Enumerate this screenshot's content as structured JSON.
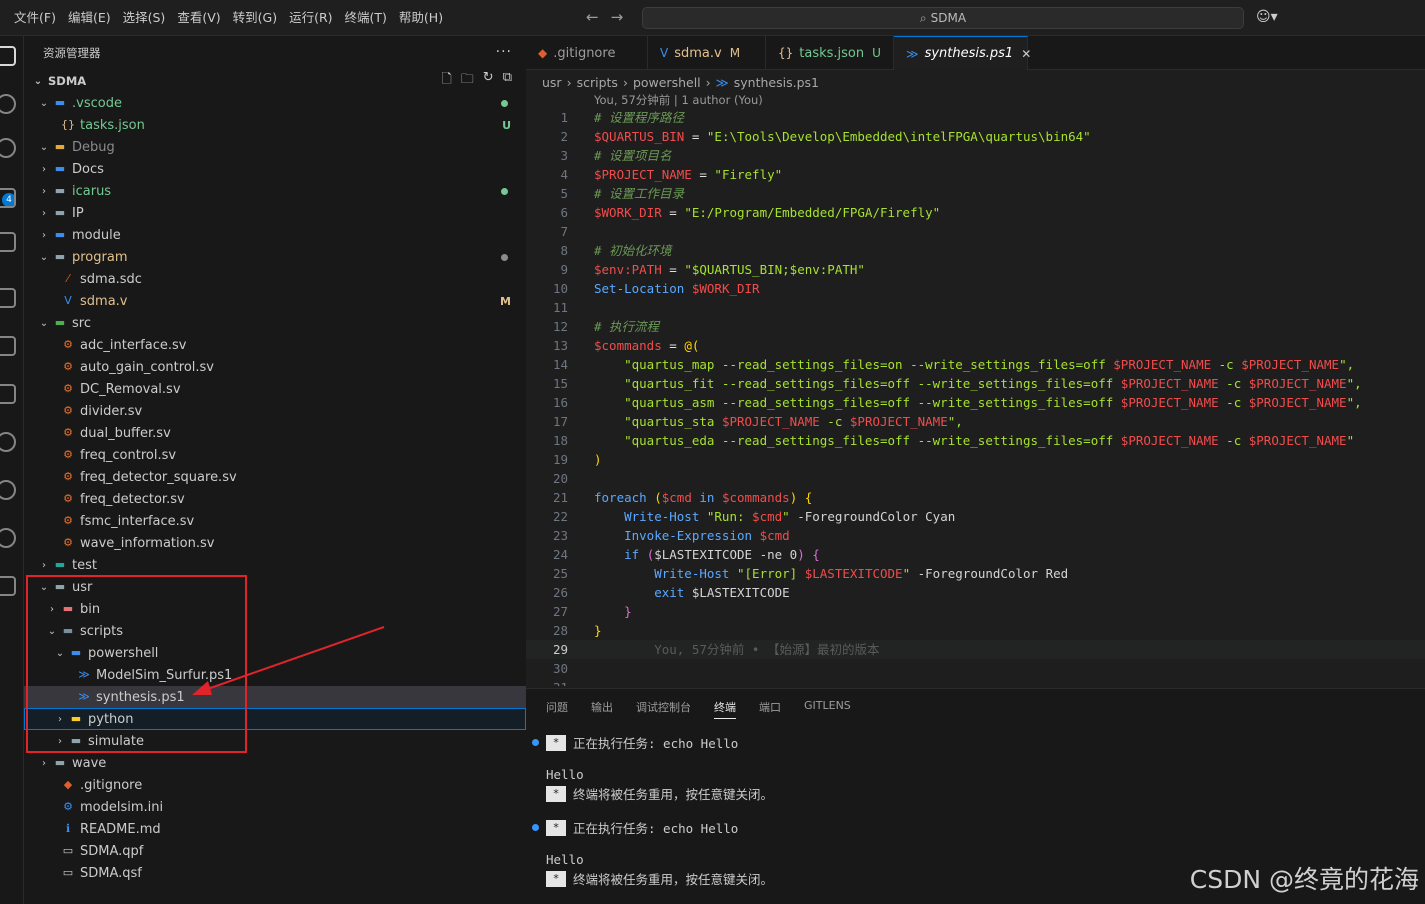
{
  "menu": [
    "文件(F)",
    "编辑(E)",
    "选择(S)",
    "查看(V)",
    "转到(G)",
    "运行(R)",
    "终端(T)",
    "帮助(H)"
  ],
  "search": {
    "text": "SDMA"
  },
  "activity": {
    "badge": "4"
  },
  "sidebar": {
    "title": "资源管理器",
    "folder": "SDMA",
    "tree": [
      {
        "label": ".vscode",
        "indent": 1,
        "chevron": "open",
        "icon": "folder-vscode-icon",
        "color": "#73c991",
        "dot": "#73c991"
      },
      {
        "label": "tasks.json",
        "indent": 2,
        "icon": "json-icon",
        "color": "#73c991",
        "deco": "U",
        "decoColor": "#73c991"
      },
      {
        "label": "Debug",
        "indent": 1,
        "chevron": "open",
        "icon": "folder-debug-icon",
        "color": "#8c8c8c"
      },
      {
        "label": "Docs",
        "indent": 1,
        "chevron": "closed",
        "icon": "folder-docs-icon",
        "color": "#cccccc"
      },
      {
        "label": "icarus",
        "indent": 1,
        "chevron": "closed",
        "icon": "folder-icon",
        "color": "#73c991",
        "dot": "#73c991"
      },
      {
        "label": "IP",
        "indent": 1,
        "chevron": "closed",
        "icon": "folder-icon",
        "color": "#cccccc"
      },
      {
        "label": "module",
        "indent": 1,
        "chevron": "closed",
        "icon": "folder-module-icon",
        "color": "#cccccc"
      },
      {
        "label": "program",
        "indent": 1,
        "chevron": "open",
        "icon": "folder-icon",
        "color": "#e2c08d",
        "dot": "#8c8c8c"
      },
      {
        "label": "sdma.sdc",
        "indent": 2,
        "icon": "sdc-file-icon",
        "color": "#cccccc"
      },
      {
        "label": "sdma.v",
        "indent": 2,
        "icon": "verilog-icon",
        "color": "#e2c08d",
        "deco": "M",
        "decoColor": "#e2c08d"
      },
      {
        "label": "src",
        "indent": 1,
        "chevron": "open",
        "icon": "folder-src-icon",
        "color": "#cccccc"
      },
      {
        "label": "adc_interface.sv",
        "indent": 2,
        "icon": "systemverilog-icon",
        "color": "#cccccc"
      },
      {
        "label": "auto_gain_control.sv",
        "indent": 2,
        "icon": "systemverilog-icon",
        "color": "#cccccc"
      },
      {
        "label": "DC_Removal.sv",
        "indent": 2,
        "icon": "systemverilog-icon",
        "color": "#cccccc"
      },
      {
        "label": "divider.sv",
        "indent": 2,
        "icon": "systemverilog-icon",
        "color": "#cccccc"
      },
      {
        "label": "dual_buffer.sv",
        "indent": 2,
        "icon": "systemverilog-icon",
        "color": "#cccccc"
      },
      {
        "label": "freq_control.sv",
        "indent": 2,
        "icon": "systemverilog-icon",
        "color": "#cccccc"
      },
      {
        "label": "freq_detector_square.sv",
        "indent": 2,
        "icon": "systemverilog-icon",
        "color": "#cccccc"
      },
      {
        "label": "freq_detector.sv",
        "indent": 2,
        "icon": "systemverilog-icon",
        "color": "#cccccc"
      },
      {
        "label": "fsmc_interface.sv",
        "indent": 2,
        "icon": "systemverilog-icon",
        "color": "#cccccc"
      },
      {
        "label": "wave_information.sv",
        "indent": 2,
        "icon": "systemverilog-icon",
        "color": "#cccccc"
      },
      {
        "label": "test",
        "indent": 1,
        "chevron": "closed",
        "icon": "folder-test-icon",
        "color": "#cccccc"
      },
      {
        "label": "usr",
        "indent": 1,
        "chevron": "open",
        "icon": "folder-icon",
        "color": "#cccccc"
      },
      {
        "label": "bin",
        "indent": 2,
        "chevron": "closed",
        "icon": "folder-bin-icon",
        "color": "#cccccc"
      },
      {
        "label": "scripts",
        "indent": 2,
        "chevron": "open",
        "icon": "folder-scripts-icon",
        "color": "#cccccc"
      },
      {
        "label": "powershell",
        "indent": 3,
        "chevron": "open",
        "icon": "folder-powershell-icon",
        "color": "#cccccc"
      },
      {
        "label": "ModelSim_Surfur.ps1",
        "indent": 4,
        "icon": "powershell-icon",
        "color": "#cccccc"
      },
      {
        "label": "synthesis.ps1",
        "indent": 4,
        "icon": "powershell-icon",
        "color": "#cccccc",
        "selected": true
      },
      {
        "label": "python",
        "indent": 3,
        "chevron": "closed",
        "icon": "folder-python-icon",
        "color": "#cccccc",
        "focused": true
      },
      {
        "label": "simulate",
        "indent": 3,
        "chevron": "closed",
        "icon": "folder-icon",
        "color": "#cccccc"
      },
      {
        "label": "wave",
        "indent": 1,
        "chevron": "closed",
        "icon": "folder-icon",
        "color": "#cccccc"
      },
      {
        "label": ".gitignore",
        "indent": 2,
        "icon": "git-icon",
        "color": "#cccccc"
      },
      {
        "label": "modelsim.ini",
        "indent": 2,
        "icon": "settings-file-icon",
        "color": "#cccccc"
      },
      {
        "label": "README.md",
        "indent": 2,
        "icon": "info-icon",
        "color": "#cccccc"
      },
      {
        "label": "SDMA.qpf",
        "indent": 2,
        "icon": "file-icon",
        "color": "#cccccc"
      },
      {
        "label": "SDMA.qsf",
        "indent": 2,
        "icon": "file-icon",
        "color": "#cccccc"
      }
    ]
  },
  "tabs": [
    {
      "label": ".gitignore",
      "icon": "git-icon",
      "iconColor": "#e05d2d",
      "status": "",
      "width": 122
    },
    {
      "label": "sdma.v",
      "icon": "verilog-icon",
      "iconColor": "#3b8eea",
      "status": "M",
      "statusColor": "#e2c08d",
      "labelColor": "#e2c08d",
      "width": 118
    },
    {
      "label": "tasks.json",
      "icon": "json-icon",
      "iconColor": "#e2c08d",
      "status": "U",
      "statusColor": "#73c991",
      "labelColor": "#73c991",
      "width": 128
    },
    {
      "label": "synthesis.ps1",
      "icon": "powershell-icon",
      "iconColor": "#3b8eea",
      "status": "✕",
      "statusColor": "#cccccc",
      "active": true,
      "width": 134
    }
  ],
  "breadcrumb": [
    "usr",
    "scripts",
    "powershell",
    "synthesis.ps1"
  ],
  "blame": "You, 57分钟前 | 1 author (You)",
  "code": [
    [
      [
        "# 设置程序路径",
        "com"
      ]
    ],
    [
      [
        "$QUARTUS_BIN",
        "var"
      ],
      [
        " = ",
        "op"
      ],
      [
        "\"E:\\Tools\\Develop\\Embedded\\intelFPGA\\quartus\\bin64\"",
        "str"
      ]
    ],
    [
      [
        "# 设置项目名",
        "com"
      ]
    ],
    [
      [
        "$PROJECT_NAME",
        "var"
      ],
      [
        " = ",
        "op"
      ],
      [
        "\"Firefly\"",
        "str"
      ]
    ],
    [
      [
        "# 设置工作目录",
        "com"
      ]
    ],
    [
      [
        "$WORK_DIR",
        "var"
      ],
      [
        " = ",
        "op"
      ],
      [
        "\"E:/Program/Embedded/FPGA/Firefly\"",
        "str"
      ]
    ],
    [],
    [
      [
        "# 初始化环境",
        "com"
      ]
    ],
    [
      [
        "$env:PATH",
        "var"
      ],
      [
        " = ",
        "op"
      ],
      [
        "\"$QUARTUS_BIN;$env:PATH\"",
        "str"
      ]
    ],
    [
      [
        "Set-Location",
        "kw"
      ],
      [
        " ",
        "op"
      ],
      [
        "$WORK_DIR",
        "var"
      ]
    ],
    [],
    [
      [
        "# 执行流程",
        "com"
      ]
    ],
    [
      [
        "$commands",
        "var"
      ],
      [
        " = ",
        "op"
      ],
      [
        "@(",
        "br"
      ]
    ],
    [
      [
        "    \"quartus_map --read_settings_files=on --write_settings_files=off ",
        "str"
      ],
      [
        "$PROJECT_NAME",
        "var"
      ],
      [
        " -c ",
        "str"
      ],
      [
        "$PROJECT_NAME",
        "var"
      ],
      [
        "\",",
        "str"
      ]
    ],
    [
      [
        "    \"quartus_fit --read_settings_files=off --write_settings_files=off ",
        "str"
      ],
      [
        "$PROJECT_NAME",
        "var"
      ],
      [
        " -c ",
        "str"
      ],
      [
        "$PROJECT_NAME",
        "var"
      ],
      [
        "\",",
        "str"
      ]
    ],
    [
      [
        "    \"quartus_asm --read_settings_files=off --write_settings_files=off ",
        "str"
      ],
      [
        "$PROJECT_NAME",
        "var"
      ],
      [
        " -c ",
        "str"
      ],
      [
        "$PROJECT_NAME",
        "var"
      ],
      [
        "\",",
        "str"
      ]
    ],
    [
      [
        "    \"quartus_sta ",
        "str"
      ],
      [
        "$PROJECT_NAME",
        "var"
      ],
      [
        " -c ",
        "str"
      ],
      [
        "$PROJECT_NAME",
        "var"
      ],
      [
        "\",",
        "str"
      ]
    ],
    [
      [
        "    \"quartus_eda --read_settings_files=off --write_settings_files=off ",
        "str"
      ],
      [
        "$PROJECT_NAME",
        "var"
      ],
      [
        " -c ",
        "str"
      ],
      [
        "$PROJECT_NAME",
        "var"
      ],
      [
        "\"",
        "str"
      ]
    ],
    [
      [
        ")",
        "br"
      ]
    ],
    [],
    [
      [
        "foreach",
        "kw"
      ],
      [
        " ",
        "op"
      ],
      [
        "(",
        "br"
      ],
      [
        "$cmd",
        "var"
      ],
      [
        " in ",
        "kw"
      ],
      [
        "$commands",
        "var"
      ],
      [
        ")",
        "br"
      ],
      [
        " ",
        "op"
      ],
      [
        "{",
        "br"
      ]
    ],
    [
      [
        "    Write-Host",
        "kw"
      ],
      [
        " \"Run: ",
        "str"
      ],
      [
        "$cmd",
        "var"
      ],
      [
        "\"",
        "str"
      ],
      [
        " -ForegroundColor Cyan",
        "plain"
      ]
    ],
    [
      [
        "    Invoke-Expression",
        "kw"
      ],
      [
        " ",
        "op"
      ],
      [
        "$cmd",
        "var"
      ]
    ],
    [
      [
        "    if",
        "kw"
      ],
      [
        " ",
        "op"
      ],
      [
        "(",
        "br2"
      ],
      [
        "$LASTEXITCODE -ne 0",
        "plain"
      ],
      [
        ")",
        "br2"
      ],
      [
        " ",
        "op"
      ],
      [
        "{",
        "br2"
      ]
    ],
    [
      [
        "        Write-Host",
        "kw"
      ],
      [
        " \"[Error] ",
        "str"
      ],
      [
        "$LASTEXITCODE",
        "var"
      ],
      [
        "\"",
        "str"
      ],
      [
        " -ForegroundColor Red",
        "plain"
      ]
    ],
    [
      [
        "        exit",
        "kw"
      ],
      [
        " $LASTEXITCODE",
        "plain"
      ]
    ],
    [
      [
        "    }",
        "br2"
      ]
    ],
    [
      [
        "}",
        "br"
      ]
    ],
    [
      [
        "        You, 57分钟前 • 【始源】最初的版本",
        "ghost"
      ]
    ],
    [],
    []
  ],
  "panel": {
    "tabs": [
      "问题",
      "输出",
      "调试控制台",
      "终端",
      "端口",
      "GITLENS"
    ],
    "active": "终端",
    "lines": [
      {
        "text": "正在执行任务: echo Hello",
        "star": true,
        "dot": true
      },
      {
        "text": "Hello"
      },
      {
        "text": "终端将被任务重用，按任意键关闭。",
        "star": true
      },
      {
        "text": "正在执行任务: echo Hello",
        "star": true,
        "dot": true
      },
      {
        "text": "Hello"
      },
      {
        "text": "终端将被任务重用，按任意键关闭。",
        "star": true
      }
    ]
  },
  "watermark": "CSDN @终竟的花海"
}
